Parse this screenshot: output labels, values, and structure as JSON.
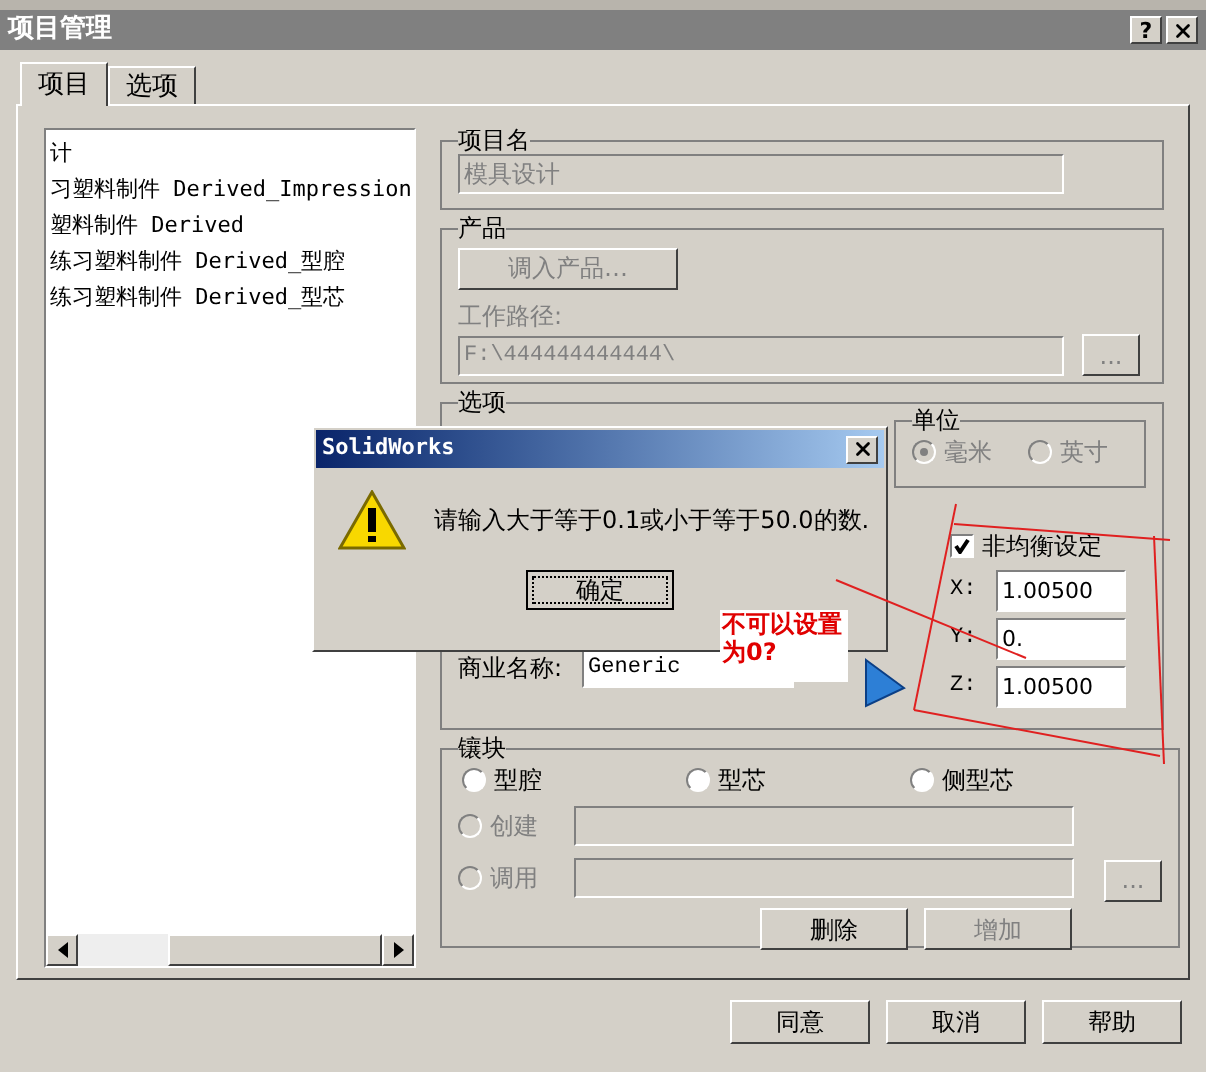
{
  "window": {
    "title": "项目管理",
    "help_button": "?"
  },
  "tabs": [
    {
      "label": "项目",
      "selected": true
    },
    {
      "label": "选项",
      "selected": false
    }
  ],
  "project_list": {
    "items": [
      "计",
      "习塑料制件 Derived_Impression",
      "塑料制件 Derived",
      "练习塑料制件 Derived_型腔",
      "练习塑料制件 Derived_型芯"
    ]
  },
  "project_name": {
    "legend": "项目名",
    "value": "模具设计",
    "disabled": true
  },
  "product": {
    "legend": "产品",
    "load_button": {
      "label": "调入产品…",
      "disabled": true
    },
    "path_label": "工作路径:",
    "path_value": "F:\\444444444444\\",
    "browse_button": {
      "label": "...",
      "disabled": true
    }
  },
  "options": {
    "legend": "选项",
    "units": {
      "legend": "单位",
      "options": [
        {
          "label": "毫米",
          "selected": true,
          "disabled": true
        },
        {
          "label": "英寸",
          "selected": false,
          "disabled": true
        }
      ]
    },
    "non_uniform": {
      "label": "非均衡设定",
      "checked": true
    },
    "scale": [
      {
        "label": "X:",
        "value": "1.00500"
      },
      {
        "label": "Y:",
        "value": "0."
      },
      {
        "label": "Z:",
        "value": "1.00500"
      }
    ],
    "trade_name": {
      "label": "商业名称:",
      "value": "Generic"
    }
  },
  "insert": {
    "legend": "镶块",
    "types": [
      {
        "label": "型腔",
        "selected": false
      },
      {
        "label": "型芯",
        "selected": false
      },
      {
        "label": "侧型芯",
        "selected": false
      }
    ],
    "modes": [
      {
        "label": "创建",
        "selected": false,
        "disabled": true
      },
      {
        "label": "调用",
        "selected": false,
        "disabled": true
      }
    ],
    "browse_button": {
      "label": "...",
      "disabled": true
    },
    "delete_button": {
      "label": "删除",
      "disabled": false
    },
    "add_button": {
      "label": "增加",
      "disabled": true
    }
  },
  "footer_buttons": [
    "同意",
    "取消",
    "帮助"
  ],
  "message_box": {
    "title": "SolidWorks",
    "message": "请输入大于等于0.1或小于等于50.0的数.",
    "ok_button": "确定"
  },
  "annotation": {
    "text": "不可以设置为0?"
  }
}
